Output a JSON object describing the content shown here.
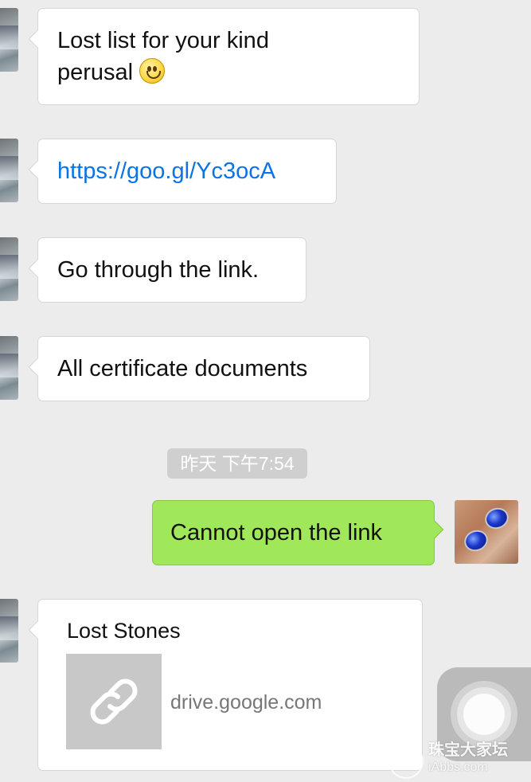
{
  "messages": [
    {
      "text": "Lost list for your kind",
      "text2": "perusal",
      "emoji": "smile-emoji"
    },
    {
      "link": "https://goo.gl/Yc3ocA"
    },
    {
      "text": "Go through the link."
    },
    {
      "text": "All certificate documents"
    }
  ],
  "timestamp": "昨天 下午7:54",
  "sent_message": "Cannot open the link",
  "link_card": {
    "title": "Lost Stones",
    "domain": "drive.google.com",
    "icon": "link-icon"
  },
  "watermark": {
    "name": "珠宝大家坛",
    "url": "iAbbs.com"
  },
  "colors": {
    "background": "#ececec",
    "sent_bubble": "#a0e75a",
    "link": "#0a73e6",
    "timestamp_bg": "#cfcfcf"
  }
}
